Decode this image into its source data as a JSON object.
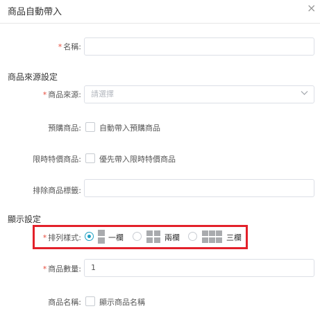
{
  "dialog": {
    "title": "商品自動帶入",
    "close_symbol": "×"
  },
  "form": {
    "name": {
      "required": "*",
      "label": "名稱:",
      "value": ""
    },
    "source_section": "商品來源設定",
    "source": {
      "required": "*",
      "label": "商品來源:",
      "placeholder": "請選擇"
    },
    "preorder": {
      "label": "預購商品:",
      "option": "自動帶入預購商品",
      "checked": false
    },
    "limited": {
      "label": "限時特價商品:",
      "option": "優先帶入限時特價商品",
      "checked": false
    },
    "exclude": {
      "label": "排除商品標籤:",
      "value": ""
    },
    "display_section": "顯示設定",
    "layout": {
      "required": "*",
      "label": "排列樣式:",
      "options": [
        {
          "label": "一欄",
          "icon": "one-column-icon",
          "selected": true
        },
        {
          "label": "兩欄",
          "icon": "two-column-icon",
          "selected": false
        },
        {
          "label": "三欄",
          "icon": "three-column-icon",
          "selected": false
        }
      ]
    },
    "count": {
      "required": "*",
      "label": "商品數量:",
      "value": "1"
    },
    "show_name": {
      "label": "商品名稱:",
      "option": "顯示商品名稱",
      "checked": false
    }
  },
  "colors": {
    "required": "#e74c3c",
    "accent": "#1ea0c3",
    "highlight_border": "#e3202a"
  }
}
